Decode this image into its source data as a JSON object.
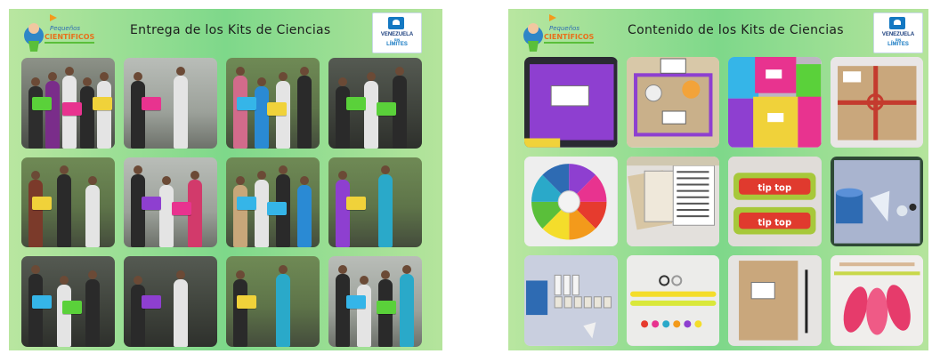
{
  "left_panel": {
    "title": "Entrega de los Kits de Ciencias",
    "logo_left": {
      "line1": "Pequeños",
      "line2": "CIENTÍFICOS"
    },
    "logo_right": {
      "line1": "VENEZUELA",
      "line2": "SIN",
      "line3": "LÍMITES"
    },
    "photos": [
      {
        "kind": "photo",
        "boxes": [
          "#5ad13a",
          "#e8338f",
          "#f0d23a"
        ],
        "shirts": [
          "#2d2d2d",
          "#7a2d8a",
          "#e6e6e6",
          "#2a2a2a",
          "#e4e4e4"
        ]
      },
      {
        "kind": "photo light",
        "boxes": [
          "#e8338f"
        ],
        "shirts": [
          "#2a2a2a",
          "#e4e4e4"
        ]
      },
      {
        "kind": "photo green",
        "boxes": [
          "#35b5e8",
          "#f0d23a"
        ],
        "shirts": [
          "#d26b8b",
          "#2a8ad4",
          "#e4e4e4",
          "#2a2a2a"
        ]
      },
      {
        "kind": "photo dark",
        "boxes": [
          "#5ad13a",
          "#5ad13a"
        ],
        "shirts": [
          "#2a2a2a",
          "#e4e4e4",
          "#2a2a2a"
        ]
      },
      {
        "kind": "photo green",
        "boxes": [
          "#f0d23a"
        ],
        "shirts": [
          "#7b3a2a",
          "#2a2a2a",
          "#e4e4e4"
        ]
      },
      {
        "kind": "photo light",
        "boxes": [
          "#8e3fd0",
          "#e8338f"
        ],
        "shirts": [
          "#2a2a2a",
          "#e4e4e4",
          "#d23a6b"
        ]
      },
      {
        "kind": "photo green",
        "boxes": [
          "#35b5e8",
          "#35b5e8"
        ],
        "shirts": [
          "#c8a77a",
          "#e4e4e4",
          "#2a2a2a",
          "#2a8ad4"
        ]
      },
      {
        "kind": "photo green",
        "boxes": [
          "#f0d23a"
        ],
        "shirts": [
          "#8e3fd0",
          "#2aa9c9"
        ]
      },
      {
        "kind": "photo dark",
        "boxes": [
          "#35b5e8",
          "#5ad13a"
        ],
        "shirts": [
          "#2a2a2a",
          "#e4e4e4",
          "#2a2a2a"
        ]
      },
      {
        "kind": "photo dark",
        "boxes": [
          "#8e3fd0"
        ],
        "shirts": [
          "#2a2a2a",
          "#e4e4e4"
        ]
      },
      {
        "kind": "photo green",
        "boxes": [
          "#f0d23a"
        ],
        "shirts": [
          "#2a2a2a",
          "#2aa9c9"
        ]
      },
      {
        "kind": "photo light",
        "boxes": [
          "#35b5e8",
          "#5ad13a"
        ],
        "shirts": [
          "#2a2a2a",
          "#e4e4e4",
          "#2a2a2a",
          "#2aa9c9"
        ]
      }
    ]
  },
  "right_panel": {
    "title": "Contenido de los Kits de Ciencias",
    "logo_left": {
      "line1": "Pequeños",
      "line2": "CIENTÍFICOS"
    },
    "logo_right": {
      "line1": "VENEZUELA",
      "line2": "SIN",
      "line3": "LÍMITES"
    },
    "items": [
      {
        "name": "purple-box"
      },
      {
        "name": "open-kit-box"
      },
      {
        "name": "colored-boxes"
      },
      {
        "name": "kraft-box-with-ribbon"
      },
      {
        "name": "color-wheel"
      },
      {
        "name": "printed-worksheets"
      },
      {
        "name": "candy-packs",
        "brand": "tip top"
      },
      {
        "name": "blue-cup-and-clay"
      },
      {
        "name": "cup-and-vials"
      },
      {
        "name": "rings-and-beads"
      },
      {
        "name": "folder-and-pencil"
      },
      {
        "name": "pink-balloons"
      }
    ]
  },
  "colors": {
    "panel_bg": "#7ed88a",
    "kit_purple": "#8e3fd0",
    "kit_pink": "#e8338f",
    "kit_yellow": "#f0d23a",
    "kit_green": "#5ad13a",
    "kit_blue": "#35b5e8"
  }
}
